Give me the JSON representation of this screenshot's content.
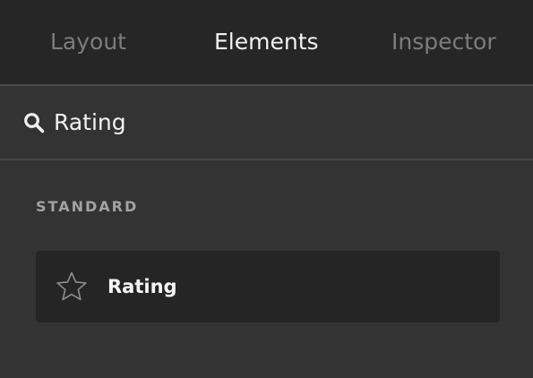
{
  "tabs": {
    "layout": "Layout",
    "elements": "Elements",
    "inspector": "Inspector",
    "active": "Elements"
  },
  "search": {
    "value": "Rating",
    "icon": "search-icon"
  },
  "section": {
    "title": "STANDARD"
  },
  "results": [
    {
      "label": "Rating",
      "icon": "star-icon"
    }
  ],
  "colors": {
    "panel_bg": "#333333",
    "tabbar_bg": "#262626",
    "item_bg": "#252525",
    "active_text": "#f2f2f2",
    "inactive_text": "#7d7d7d",
    "section_text": "#a3a3a3"
  }
}
